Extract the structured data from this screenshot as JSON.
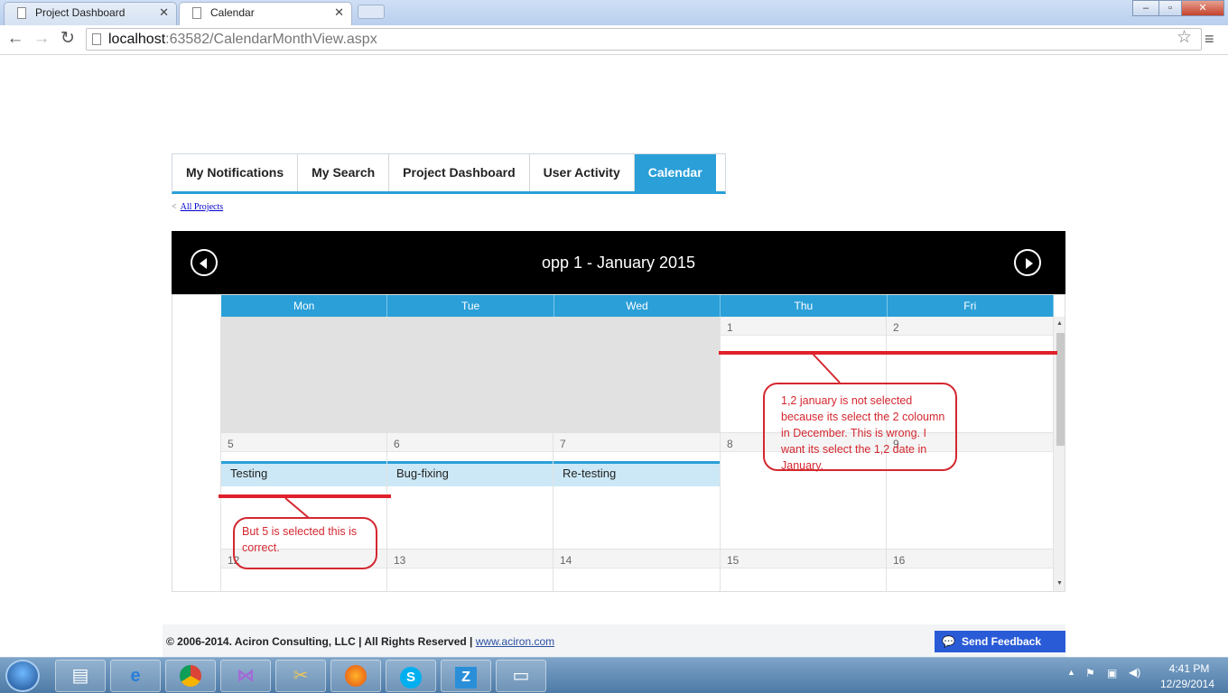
{
  "browser": {
    "tabs": [
      {
        "title": "Project Dashboard",
        "active": false
      },
      {
        "title": "Calendar",
        "active": true
      }
    ],
    "url_host": "localhost",
    "url_rest": ":63582/CalendarMonthView.aspx"
  },
  "nav_tabs": [
    "My Notifications",
    "My Search",
    "Project Dashboard",
    "User Activity",
    "Calendar"
  ],
  "active_tab": "Calendar",
  "breadcrumb": {
    "prefix": "<",
    "link": "All Projects"
  },
  "calendar": {
    "title": "opp 1 - January 2015",
    "day_headers": [
      "Mon",
      "Tue",
      "Wed",
      "Thu",
      "Fri"
    ],
    "week1": {
      "thu": "1",
      "fri": "2"
    },
    "week2": {
      "mon": "5",
      "tue": "6",
      "wed": "7",
      "thu": "8",
      "fri": "9"
    },
    "week3": {
      "mon": "12",
      "tue": "13",
      "wed": "14",
      "thu": "15",
      "fri": "16"
    },
    "events": {
      "mon": "Testing",
      "tue": "Bug-fixing",
      "wed": "Re-testing"
    }
  },
  "annotations": {
    "note1": "1,2 january is not selected because its select the 2 coloumn in December. This is wrong. I want its select the 1,2 date in January.",
    "note2": "But 5 is selected this is correct."
  },
  "footer": {
    "copyright": "© 2006-2014. Aciron Consulting, LLC | All Rights Reserved |",
    "link": "www.aciron.com",
    "feedback": "Send Feedback"
  },
  "taskbar": {
    "time": "4:41 PM",
    "date": "12/29/2014",
    "apps": [
      "file-explorer",
      "internet-explorer",
      "chrome",
      "visual-studio",
      "tool",
      "firefox",
      "skype",
      "z-app",
      "app"
    ]
  },
  "colors": {
    "accent": "#2a9fd8",
    "annotation": "#d42830",
    "header": "#000000"
  }
}
